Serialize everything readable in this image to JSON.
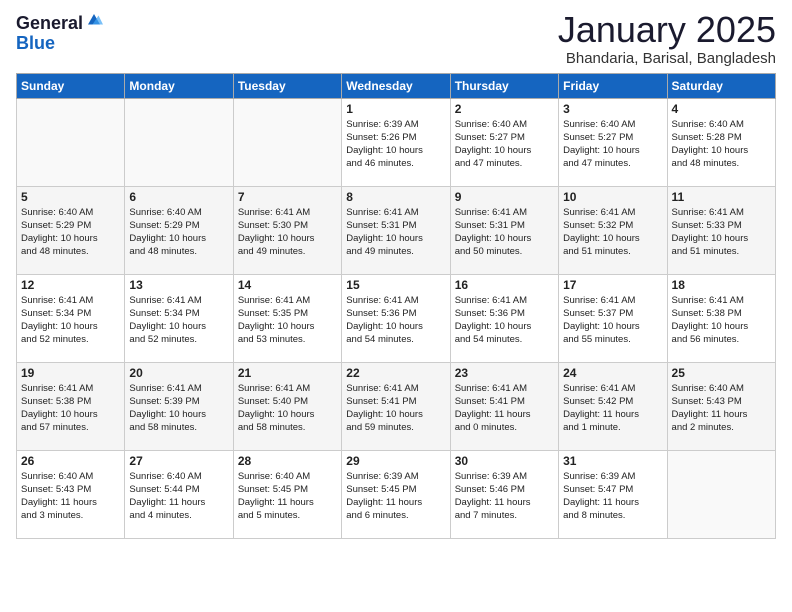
{
  "header": {
    "logo_general": "General",
    "logo_blue": "Blue",
    "title": "January 2025",
    "location": "Bhandaria, Barisal, Bangladesh"
  },
  "weekdays": [
    "Sunday",
    "Monday",
    "Tuesday",
    "Wednesday",
    "Thursday",
    "Friday",
    "Saturday"
  ],
  "weeks": [
    [
      {
        "day": "",
        "content": ""
      },
      {
        "day": "",
        "content": ""
      },
      {
        "day": "",
        "content": ""
      },
      {
        "day": "1",
        "content": "Sunrise: 6:39 AM\nSunset: 5:26 PM\nDaylight: 10 hours\nand 46 minutes."
      },
      {
        "day": "2",
        "content": "Sunrise: 6:40 AM\nSunset: 5:27 PM\nDaylight: 10 hours\nand 47 minutes."
      },
      {
        "day": "3",
        "content": "Sunrise: 6:40 AM\nSunset: 5:27 PM\nDaylight: 10 hours\nand 47 minutes."
      },
      {
        "day": "4",
        "content": "Sunrise: 6:40 AM\nSunset: 5:28 PM\nDaylight: 10 hours\nand 48 minutes."
      }
    ],
    [
      {
        "day": "5",
        "content": "Sunrise: 6:40 AM\nSunset: 5:29 PM\nDaylight: 10 hours\nand 48 minutes."
      },
      {
        "day": "6",
        "content": "Sunrise: 6:40 AM\nSunset: 5:29 PM\nDaylight: 10 hours\nand 48 minutes."
      },
      {
        "day": "7",
        "content": "Sunrise: 6:41 AM\nSunset: 5:30 PM\nDaylight: 10 hours\nand 49 minutes."
      },
      {
        "day": "8",
        "content": "Sunrise: 6:41 AM\nSunset: 5:31 PM\nDaylight: 10 hours\nand 49 minutes."
      },
      {
        "day": "9",
        "content": "Sunrise: 6:41 AM\nSunset: 5:31 PM\nDaylight: 10 hours\nand 50 minutes."
      },
      {
        "day": "10",
        "content": "Sunrise: 6:41 AM\nSunset: 5:32 PM\nDaylight: 10 hours\nand 51 minutes."
      },
      {
        "day": "11",
        "content": "Sunrise: 6:41 AM\nSunset: 5:33 PM\nDaylight: 10 hours\nand 51 minutes."
      }
    ],
    [
      {
        "day": "12",
        "content": "Sunrise: 6:41 AM\nSunset: 5:34 PM\nDaylight: 10 hours\nand 52 minutes."
      },
      {
        "day": "13",
        "content": "Sunrise: 6:41 AM\nSunset: 5:34 PM\nDaylight: 10 hours\nand 52 minutes."
      },
      {
        "day": "14",
        "content": "Sunrise: 6:41 AM\nSunset: 5:35 PM\nDaylight: 10 hours\nand 53 minutes."
      },
      {
        "day": "15",
        "content": "Sunrise: 6:41 AM\nSunset: 5:36 PM\nDaylight: 10 hours\nand 54 minutes."
      },
      {
        "day": "16",
        "content": "Sunrise: 6:41 AM\nSunset: 5:36 PM\nDaylight: 10 hours\nand 54 minutes."
      },
      {
        "day": "17",
        "content": "Sunrise: 6:41 AM\nSunset: 5:37 PM\nDaylight: 10 hours\nand 55 minutes."
      },
      {
        "day": "18",
        "content": "Sunrise: 6:41 AM\nSunset: 5:38 PM\nDaylight: 10 hours\nand 56 minutes."
      }
    ],
    [
      {
        "day": "19",
        "content": "Sunrise: 6:41 AM\nSunset: 5:38 PM\nDaylight: 10 hours\nand 57 minutes."
      },
      {
        "day": "20",
        "content": "Sunrise: 6:41 AM\nSunset: 5:39 PM\nDaylight: 10 hours\nand 58 minutes."
      },
      {
        "day": "21",
        "content": "Sunrise: 6:41 AM\nSunset: 5:40 PM\nDaylight: 10 hours\nand 58 minutes."
      },
      {
        "day": "22",
        "content": "Sunrise: 6:41 AM\nSunset: 5:41 PM\nDaylight: 10 hours\nand 59 minutes."
      },
      {
        "day": "23",
        "content": "Sunrise: 6:41 AM\nSunset: 5:41 PM\nDaylight: 11 hours\nand 0 minutes."
      },
      {
        "day": "24",
        "content": "Sunrise: 6:41 AM\nSunset: 5:42 PM\nDaylight: 11 hours\nand 1 minute."
      },
      {
        "day": "25",
        "content": "Sunrise: 6:40 AM\nSunset: 5:43 PM\nDaylight: 11 hours\nand 2 minutes."
      }
    ],
    [
      {
        "day": "26",
        "content": "Sunrise: 6:40 AM\nSunset: 5:43 PM\nDaylight: 11 hours\nand 3 minutes."
      },
      {
        "day": "27",
        "content": "Sunrise: 6:40 AM\nSunset: 5:44 PM\nDaylight: 11 hours\nand 4 minutes."
      },
      {
        "day": "28",
        "content": "Sunrise: 6:40 AM\nSunset: 5:45 PM\nDaylight: 11 hours\nand 5 minutes."
      },
      {
        "day": "29",
        "content": "Sunrise: 6:39 AM\nSunset: 5:45 PM\nDaylight: 11 hours\nand 6 minutes."
      },
      {
        "day": "30",
        "content": "Sunrise: 6:39 AM\nSunset: 5:46 PM\nDaylight: 11 hours\nand 7 minutes."
      },
      {
        "day": "31",
        "content": "Sunrise: 6:39 AM\nSunset: 5:47 PM\nDaylight: 11 hours\nand 8 minutes."
      },
      {
        "day": "",
        "content": ""
      }
    ]
  ]
}
